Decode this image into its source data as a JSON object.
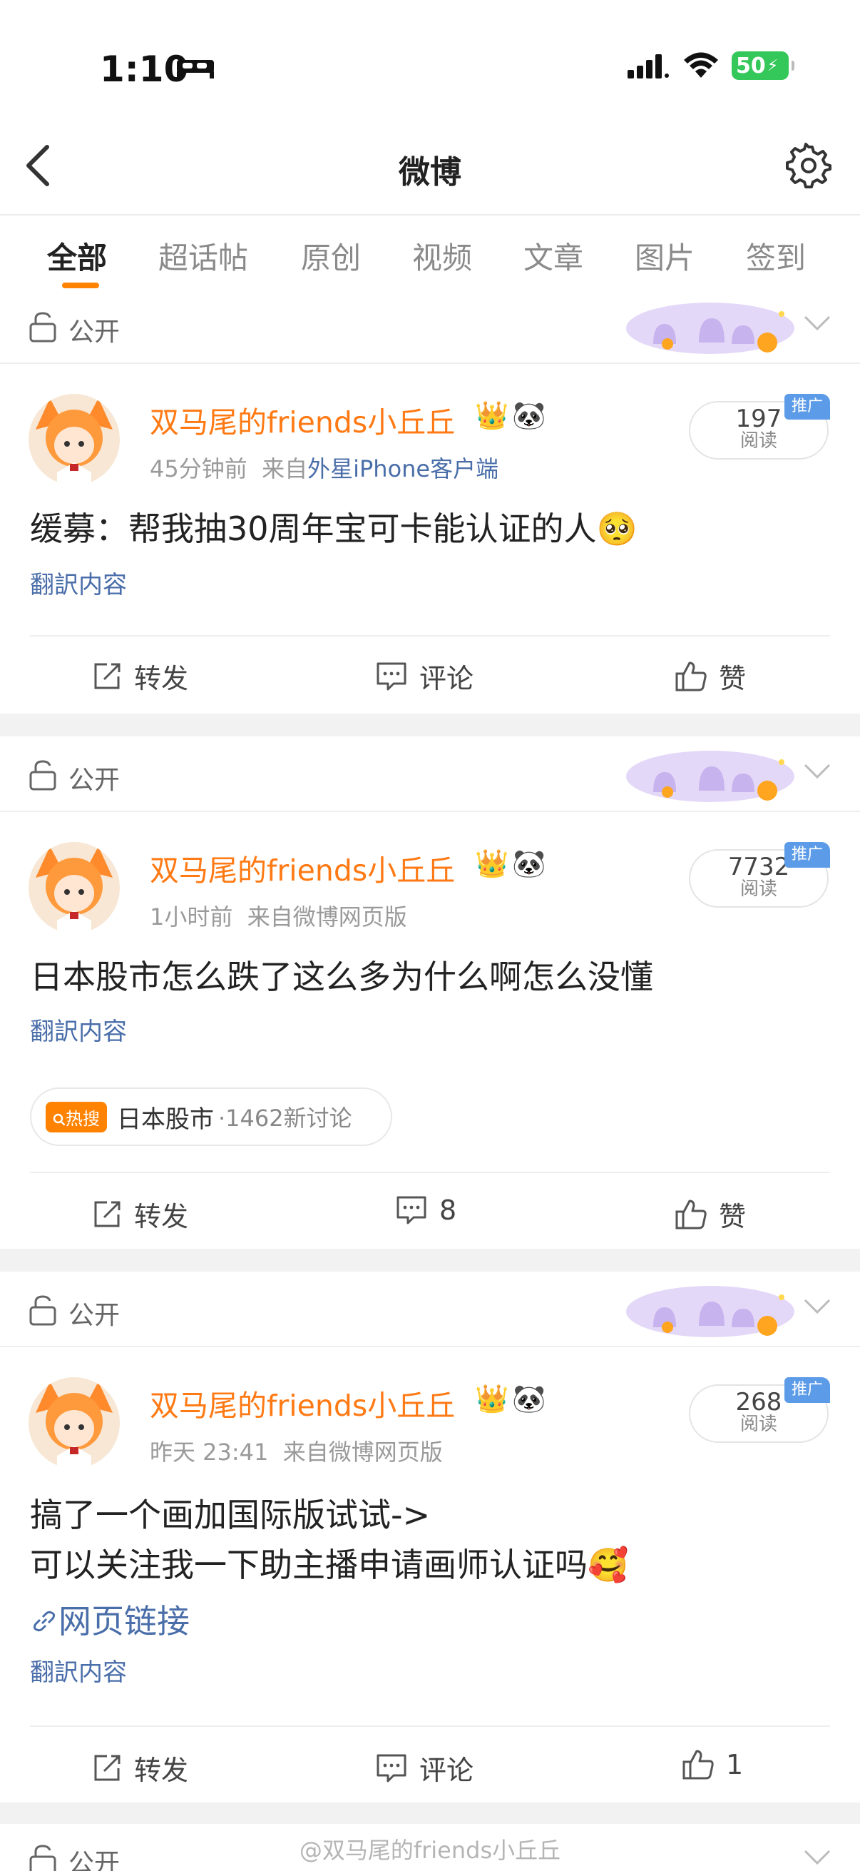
{
  "status_bar": {
    "time": "1:10",
    "battery": "50"
  },
  "nav": {
    "title": "微博"
  },
  "tabs": [
    "全部",
    "超话帖",
    "原创",
    "视频",
    "文章",
    "图片",
    "签到"
  ],
  "visibility_label": "公开",
  "posts": [
    {
      "username": "双马尾的friends小丘丘",
      "time": "45分钟前",
      "source_prefix": "来自",
      "source": "外星iPhone客户端",
      "reads": "197",
      "reads_label": "阅读",
      "promo": "推广",
      "content_lines": [
        "缓募：帮我抽30周年宝可卡能认证的人🥺"
      ],
      "translate": "翻訳内容",
      "repost": "转发",
      "comment": "评论",
      "like": "赞"
    },
    {
      "username": "双马尾的friends小丘丘",
      "time": "1小时前",
      "source_prefix": "来自",
      "source": "微博网页版",
      "reads": "7732",
      "reads_label": "阅读",
      "promo": "推广",
      "content_lines": [
        "日本股市怎么跌了这么多为什么啊怎么没懂"
      ],
      "translate": "翻訳内容",
      "hot_tag": "热搜",
      "hot_topic": "日本股市",
      "hot_count": "·1462新讨论",
      "repost": "转发",
      "comment": "8",
      "like": "赞"
    },
    {
      "username": "双马尾的friends小丘丘",
      "time": "昨天 23:41",
      "source_prefix": "来自",
      "source": "微博网页版",
      "reads": "268",
      "reads_label": "阅读",
      "promo": "推广",
      "content_lines": [
        "搞了一个画加国际版试试->",
        "可以关注我一下助主播申请画师认证吗🥰"
      ],
      "link": "网页链接",
      "translate": "翻訳内容",
      "repost": "转发",
      "comment": "评论",
      "like": "1"
    }
  ],
  "watermark": "@双马尾的friends小丘丘",
  "colors": {
    "accent": "#ff8200",
    "username": "#ff7a14",
    "link": "#4a6ea9",
    "promo": "#5b9be8"
  }
}
